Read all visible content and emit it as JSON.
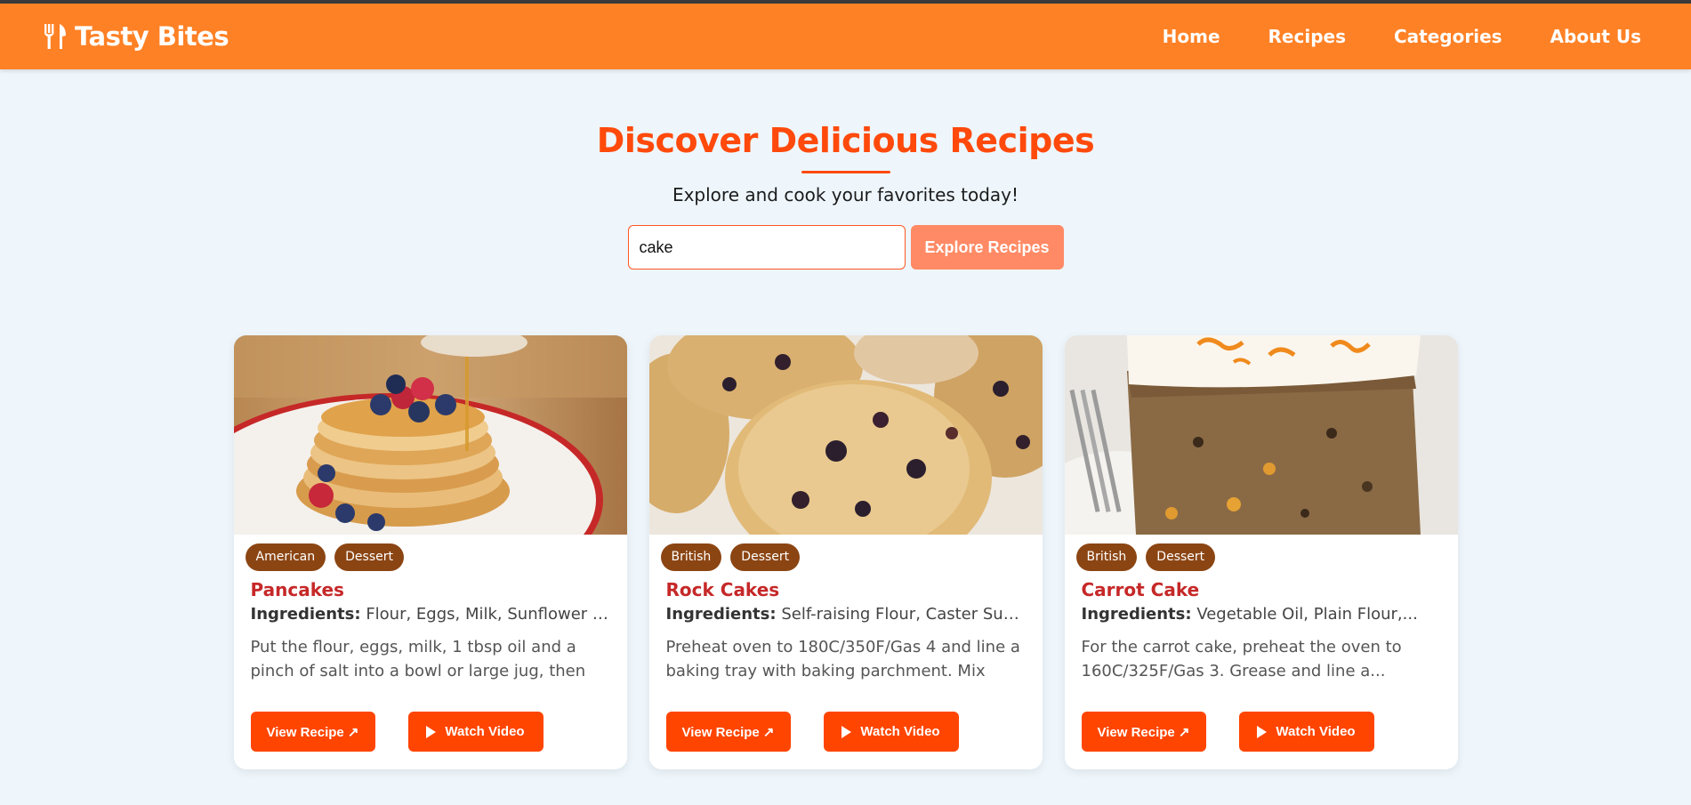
{
  "brand": {
    "name": "Tasty Bites",
    "icon": "fork-knife-icon"
  },
  "nav": {
    "links": [
      "Home",
      "Recipes",
      "Categories",
      "About Us"
    ]
  },
  "hero": {
    "title": "Discover Delicious Recipes",
    "subtitle": "Explore and cook your favorites today!",
    "search_value": "cake",
    "search_button": "Explore Recipes"
  },
  "colors": {
    "navbar": "#ff8125",
    "accent": "#ff4a0c",
    "tag": "#8b4513",
    "card_title": "#c62828",
    "background": "#eef6fc"
  },
  "recipes": [
    {
      "tags": [
        "American",
        "Dessert"
      ],
      "title": "Pancakes",
      "ingredients_label": "Ingredients:",
      "ingredients": "Flour, Eggs, Milk, Sunflower Oil...",
      "description": "Put the flour, eggs, milk, 1 tbsp oil and a pinch of salt into a bowl or large jug, then whisk to...",
      "view_label": "View Recipe ↗",
      "watch_label": "Watch Video"
    },
    {
      "tags": [
        "British",
        "Dessert"
      ],
      "title": "Rock Cakes",
      "ingredients_label": "Ingredients:",
      "ingredients": "Self-raising Flour, Caster Sugar...",
      "description": "Preheat oven to 180C/350F/Gas 4 and line a baking tray with baking parchment. Mix the...",
      "view_label": "View Recipe ↗",
      "watch_label": "Watch Video"
    },
    {
      "tags": [
        "British",
        "Dessert"
      ],
      "title": "Carrot Cake",
      "ingredients_label": "Ingredients:",
      "ingredients": "Vegetable Oil, Plain Flour,...",
      "description": "For the carrot cake, preheat the oven to 160C/325F/Gas 3. Grease and line a...",
      "view_label": "View Recipe ↗",
      "watch_label": "Watch Video"
    }
  ]
}
